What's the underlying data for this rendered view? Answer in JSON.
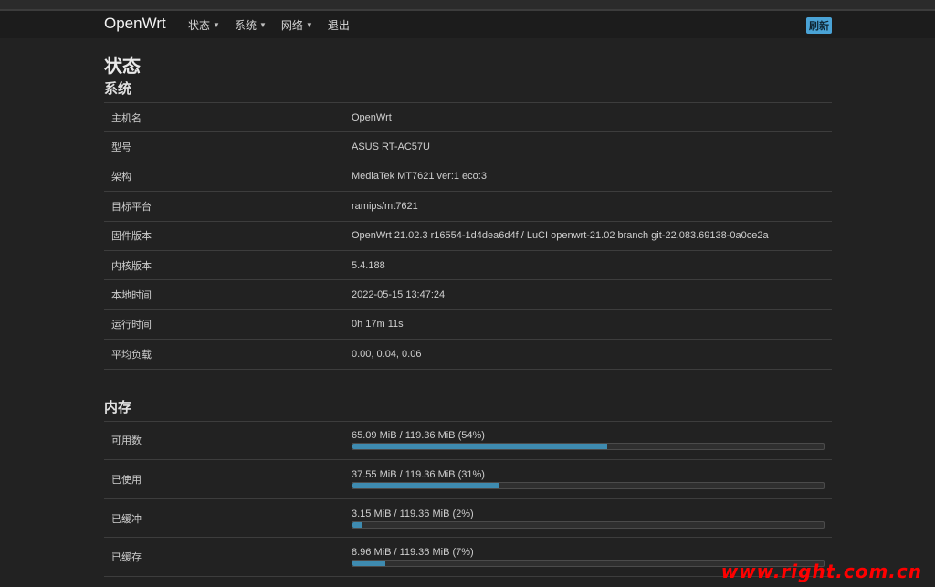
{
  "nav": {
    "brand": "OpenWrt",
    "menu": [
      "状态",
      "系统",
      "网络",
      "退出"
    ],
    "refresh": "刷新"
  },
  "page_title": "状态",
  "system": {
    "title": "系统",
    "rows": [
      {
        "k": "主机名",
        "v": "OpenWrt"
      },
      {
        "k": "型号",
        "v": "ASUS RT-AC57U"
      },
      {
        "k": "架构",
        "v": "MediaTek MT7621 ver:1 eco:3"
      },
      {
        "k": "目标平台",
        "v": "ramips/mt7621"
      },
      {
        "k": "固件版本",
        "v": "OpenWrt 21.02.3 r16554-1d4dea6d4f / LuCI openwrt-21.02 branch git-22.083.69138-0a0ce2a"
      },
      {
        "k": "内核版本",
        "v": "5.4.188"
      },
      {
        "k": "本地时间",
        "v": "2022-05-15 13:47:24"
      },
      {
        "k": "运行时间",
        "v": "0h 17m 11s"
      },
      {
        "k": "平均负载",
        "v": "0.00, 0.04, 0.06"
      }
    ]
  },
  "memory": {
    "title": "内存",
    "rows": [
      {
        "k": "可用数",
        "v": "65.09 MiB / 119.36 MiB (54%)",
        "pct": 54
      },
      {
        "k": "已使用",
        "v": "37.55 MiB / 119.36 MiB (31%)",
        "pct": 31
      },
      {
        "k": "已缓冲",
        "v": "3.15 MiB / 119.36 MiB (2%)",
        "pct": 2
      },
      {
        "k": "已缓存",
        "v": "8.96 MiB / 119.36 MiB (7%)",
        "pct": 7
      }
    ]
  },
  "watermark": "www.right.com.cn",
  "colors": {
    "background": "#222222",
    "accent": "#3e8bb0",
    "badge": "#4aa3d6",
    "watermark": "#ff0000"
  }
}
